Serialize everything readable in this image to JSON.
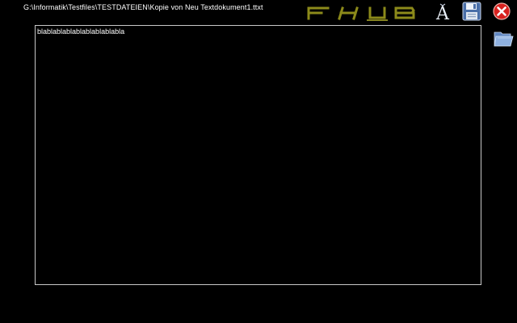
{
  "window": {
    "file_path": "G:\\Informatik\\Testfiles\\TESTDATEIEN\\Kopie von Neu Textdokument1.ttxt"
  },
  "logo": {
    "text": "FHUB",
    "color": "#8a8a1e"
  },
  "toolbar": {
    "font_icon": "font-icon",
    "save_icon": "floppy-disk-icon",
    "close_icon": "close-icon",
    "open_icon": "folder-icon",
    "close_color": "#d8221f",
    "font_glyph": "A"
  },
  "editor": {
    "content": "blablablablablablablablabla"
  }
}
